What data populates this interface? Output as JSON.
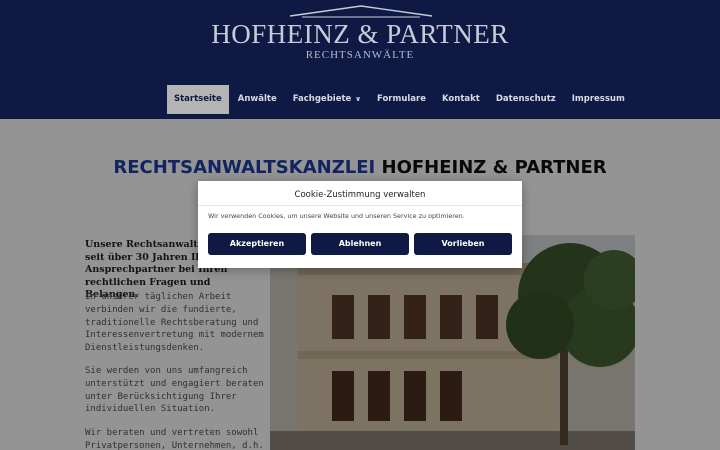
{
  "brand": {
    "title": "HOFHEINZ & PARTNER",
    "subtitle": "RECHTSANWÄLTE"
  },
  "nav": {
    "items": [
      {
        "label": "Startseite",
        "active": true
      },
      {
        "label": "Anwälte"
      },
      {
        "label": "Fachgebiete",
        "has_dropdown": true
      },
      {
        "label": "Formulare"
      },
      {
        "label": "Kontakt"
      },
      {
        "label": "Datenschutz"
      },
      {
        "label": "Impressum"
      }
    ]
  },
  "main": {
    "headline_part1": "RECHTSANWALTSKANZLEI",
    "headline_part2": "HOFHEINZ & PARTNER",
    "intro_line1": "Unsere Rechtsanwaltsk",
    "intro_line2": "seit über 30 Jahren Ihr",
    "intro_line3": "Ansprechpartner bei Ihren",
    "intro_line4": "rechtlichen Fragen und Belangen.",
    "para1": [
      "In unserer täglichen Arbeit",
      "verbinden wir die fundierte,",
      "traditionelle Rechtsberatung und",
      "Interessenvertretung mit modernem",
      "Dienstleistungsdenken."
    ],
    "para2": [
      "Sie werden von uns umfangreich",
      "unterstützt und engagiert beraten",
      "unter Berücksichtigung Ihrer",
      "individuellen Situation."
    ],
    "para3": [
      "Wir beraten und vertreten sowohl",
      "Privatpersonen, Unternehmen, d.h."
    ]
  },
  "cookie": {
    "title": "Cookie-Zustimmung verwalten",
    "text": "Wir verwenden Cookies, um unsere Website und unseren Service zu optimieren.",
    "accept_label": "Akzeptieren",
    "deny_label": "Ablehnen",
    "preferences_label": "Vorlieben"
  },
  "colors": {
    "header_bg": "#0e1a44",
    "accent_blue": "#1e3fa8",
    "button_bg": "#0e1a44"
  }
}
